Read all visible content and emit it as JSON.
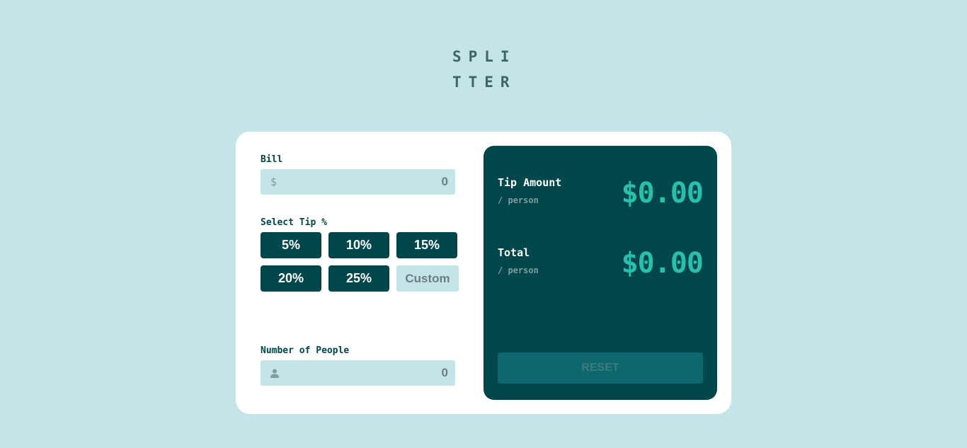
{
  "app": {
    "logo_line1": "SPLI",
    "logo_line2": "TTER"
  },
  "bill": {
    "label": "Bill",
    "currency_icon_text": "$",
    "placeholder": "0"
  },
  "tip": {
    "label": "Select Tip %",
    "options": [
      "5%",
      "10%",
      "15%",
      "20%",
      "25%"
    ],
    "custom_placeholder": "Custom"
  },
  "people": {
    "label": "Number of People",
    "icon": "person-icon",
    "placeholder": "0"
  },
  "result": {
    "tip_label": "Tip Amount",
    "tip_sub": "/ person",
    "tip_value": "$0.00",
    "total_label": "Total",
    "total_sub": "/ person",
    "total_value": "$0.00",
    "reset_label": "RESET"
  },
  "colors": {
    "background": "#c5e4e7",
    "primary": "#00474b",
    "accent": "#26c0ab",
    "reset_disabled": "#0d686d"
  }
}
